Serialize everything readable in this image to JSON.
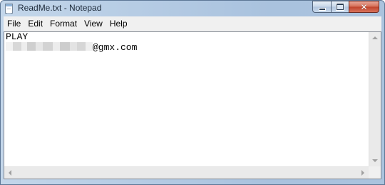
{
  "window": {
    "title": "ReadMe.txt - Notepad",
    "icon": "notepad-icon",
    "controls": {
      "minimize": "minimize-icon",
      "maximize": "maximize-icon",
      "close": "close-icon",
      "close_glyph": "✕"
    }
  },
  "menu": {
    "items": [
      {
        "label": "File"
      },
      {
        "label": "Edit"
      },
      {
        "label": "Format"
      },
      {
        "label": "View"
      },
      {
        "label": "Help"
      }
    ]
  },
  "document": {
    "lines": [
      {
        "text": "PLAY"
      },
      {
        "text": "@gmx.com",
        "redacted_prefix": true
      }
    ]
  },
  "scrollbars": {
    "vertical": {
      "up": "scroll-up-arrow-icon",
      "down": "scroll-down-arrow-icon"
    },
    "horizontal": {
      "left": "scroll-left-arrow-icon",
      "right": "scroll-right-arrow-icon"
    }
  },
  "colors": {
    "titlebar": "#b6cce4",
    "close_button": "#c0432b",
    "menubar": "#f0f0f0",
    "editor_bg": "#ffffff"
  }
}
